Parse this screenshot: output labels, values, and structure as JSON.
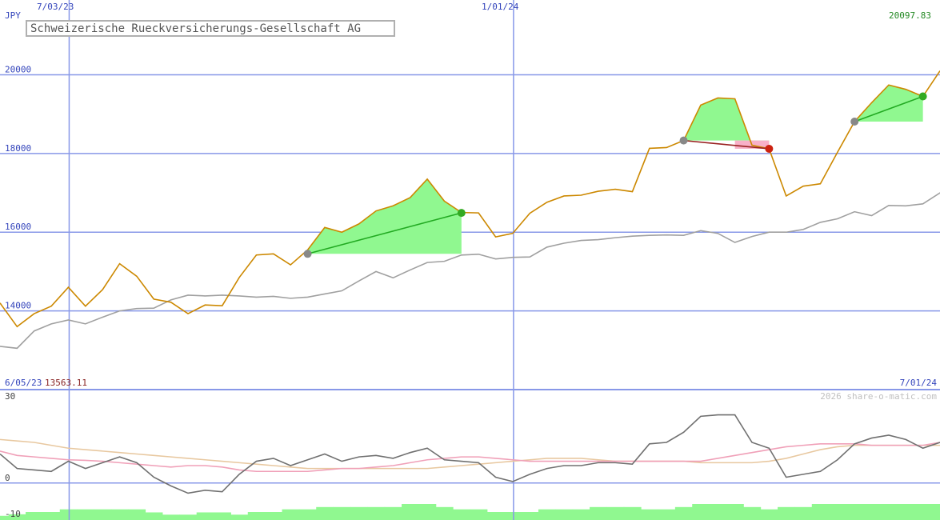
{
  "chart_data": {
    "type": "line",
    "title": "Schweizerische Rueckversicherungs-Gesellschaft AG",
    "currency": "JPY",
    "last_value": "20097.83",
    "start_value": "13563.11",
    "start_date": "6/05/23",
    "end_date": "7/01/24",
    "watermark": "2026 share-o-matic.com",
    "date_labels": [
      "7/03/23",
      "1/01/24"
    ],
    "price_ticks": [
      "20000",
      "18000",
      "16000",
      "14000"
    ],
    "price_tick_values": [
      20000,
      18000,
      16000,
      14000
    ],
    "price_ylim": [
      12000,
      21900
    ],
    "ind_ticks": [
      "30",
      "0",
      "-10"
    ],
    "ind_tick_values": [
      30,
      0,
      -10
    ],
    "ind_ylim": [
      -10,
      30
    ],
    "x": [
      "2023-06-05",
      "2023-06-12",
      "2023-06-19",
      "2023-06-26",
      "2023-07-03",
      "2023-07-10",
      "2023-07-17",
      "2023-07-24",
      "2023-07-31",
      "2023-08-07",
      "2023-08-14",
      "2023-08-21",
      "2023-08-28",
      "2023-09-04",
      "2023-09-11",
      "2023-09-18",
      "2023-09-25",
      "2023-10-02",
      "2023-10-09",
      "2023-10-16",
      "2023-10-23",
      "2023-10-30",
      "2023-11-06",
      "2023-11-13",
      "2023-11-20",
      "2023-11-27",
      "2023-12-04",
      "2023-12-11",
      "2023-12-18",
      "2023-12-25",
      "2024-01-01",
      "2024-01-08",
      "2024-01-15",
      "2024-01-22",
      "2024-01-29",
      "2024-02-05",
      "2024-02-12",
      "2024-02-19",
      "2024-02-26",
      "2024-03-04",
      "2024-03-11",
      "2024-03-18",
      "2024-03-25",
      "2024-04-01",
      "2024-04-08",
      "2024-04-15",
      "2024-04-22",
      "2024-04-29",
      "2024-05-06",
      "2024-05-13",
      "2024-05-20",
      "2024-05-27",
      "2024-06-03",
      "2024-06-10",
      "2024-06-17",
      "2024-06-24",
      "2024-07-01"
    ],
    "series": [
      {
        "name": "Schweizerische Rueckversicherungs-Gesellschaft AG",
        "color": "#cc8800",
        "values": [
          14200,
          13600,
          13930,
          14120,
          14600,
          14120,
          14540,
          15200,
          14880,
          14300,
          14220,
          13930,
          14150,
          14130,
          14850,
          15420,
          15450,
          15170,
          15550,
          16120,
          16000,
          16210,
          16540,
          16670,
          16880,
          17350,
          16790,
          16500,
          16490,
          15880,
          15970,
          16480,
          16760,
          16920,
          16940,
          17040,
          17090,
          17030,
          18130,
          18150,
          18330,
          19230,
          19410,
          19390,
          18210,
          18120,
          16920,
          17170,
          17230,
          18030,
          18810,
          19290,
          19740,
          19630,
          19450,
          20100
        ]
      },
      {
        "name": "",
        "color": "#a0a0a0",
        "values": [
          13100,
          13050,
          13490,
          13670,
          13770,
          13670,
          13840,
          14000,
          14060,
          14070,
          14280,
          14400,
          14380,
          14400,
          14380,
          14350,
          14370,
          14320,
          14350,
          14430,
          14510,
          14760,
          15000,
          14840,
          15040,
          15230,
          15260,
          15420,
          15440,
          15320,
          15360,
          15370,
          15620,
          15720,
          15790,
          15810,
          15860,
          15900,
          15920,
          15930,
          15920,
          16040,
          15970,
          15740,
          15890,
          16000,
          16000,
          16070,
          16250,
          16340,
          16520,
          16420,
          16680,
          16670,
          16720,
          17000,
          17160,
          17420,
          17700
        ]
      }
    ],
    "indicators": [
      {
        "name": "",
        "color": "#707070",
        "values": [
          10,
          5,
          4.5,
          4,
          7.5,
          5,
          7,
          9,
          7,
          2,
          -1,
          -3.5,
          -2.5,
          -3,
          3,
          7.5,
          8.5,
          6,
          8,
          10,
          7.5,
          9,
          9.5,
          8.5,
          10.5,
          12,
          8,
          7.5,
          7,
          2,
          0.5,
          3,
          5,
          6,
          6,
          7,
          7,
          6.5,
          13.5,
          14,
          17.5,
          23,
          23.5,
          23.5,
          14,
          12,
          2,
          3,
          4,
          8,
          13.5,
          15.5,
          16.5,
          15,
          12,
          14
        ]
      },
      {
        "name": "",
        "color": "#f0a0b8",
        "values": [
          11,
          9.5,
          9,
          8.5,
          8,
          7.8,
          7.5,
          7,
          6.5,
          6,
          5.5,
          6,
          6,
          5.5,
          4.5,
          4,
          4,
          4,
          4,
          4.5,
          5,
          5,
          5.5,
          6,
          7,
          8,
          8.5,
          9,
          9,
          8.5,
          8,
          7.5,
          7.5,
          7.5,
          7.5,
          7.5,
          7.5,
          7.5,
          7.5,
          7.5,
          7.5,
          7.5,
          8.5,
          9.5,
          10.5,
          11.5,
          12.5,
          13,
          13.5,
          13.5,
          13.5,
          13,
          13,
          13,
          13,
          14
        ]
      },
      {
        "name": "",
        "color": "#e8c8a0",
        "values": [
          15,
          14.5,
          14,
          13,
          12,
          11.5,
          11,
          10.5,
          10,
          9.5,
          9,
          8.5,
          8,
          7.5,
          7,
          6.5,
          6,
          5.5,
          5,
          5,
          5,
          5,
          5,
          5,
          5,
          5,
          5.5,
          6,
          6.5,
          7,
          7.5,
          8,
          8.5,
          8.5,
          8.5,
          8,
          7.5,
          7.5,
          7.5,
          7.5,
          7.5,
          7,
          7,
          7,
          7,
          7.5,
          8.5,
          10,
          11.5,
          12.5,
          13,
          13,
          13,
          13,
          13,
          13
        ]
      }
    ],
    "volume": [
      1.1,
      1.5,
      2.1,
      2.1,
      2.8,
      2.8,
      2.8,
      2.8,
      2.8,
      2.0,
      1.4,
      1.4,
      2.0,
      2.0,
      1.4,
      2.1,
      2.1,
      2.8,
      2.8,
      3.4,
      3.4,
      3.4,
      3.4,
      3.4,
      4.2,
      4.2,
      3.4,
      2.8,
      2.8,
      2.1,
      2.1,
      2.1,
      2.8,
      2.8,
      2.8,
      3.4,
      3.4,
      3.4,
      2.8,
      2.8,
      3.4,
      4.2,
      4.2,
      4.2,
      3.4,
      2.8,
      3.4,
      3.4,
      4.2,
      4.2,
      4.2,
      4.2,
      4.2,
      4.2,
      4.2,
      4.2
    ],
    "trades": [
      {
        "entry_index": 18,
        "exit_index": 27,
        "entry_value": 15450,
        "exit_value": 16490,
        "result": "gain",
        "color": "#90f890"
      },
      {
        "entry_index": 40,
        "exit_index": 45,
        "entry_value": 18330,
        "exit_value": 18120,
        "result": "loss",
        "color": "#f8b0c8"
      },
      {
        "entry_index": 50,
        "exit_index": 54,
        "entry_value": 18810,
        "exit_value": 19450,
        "result": "gain",
        "color": "#90f890"
      }
    ],
    "colors": {
      "grid": "#8898e8",
      "label_blue": "#3344bb",
      "label_green": "#228822",
      "label_red": "#882222",
      "volume": "#90f890",
      "gain_line": "#22aa22",
      "loss_line": "#992222"
    },
    "grid": true
  }
}
